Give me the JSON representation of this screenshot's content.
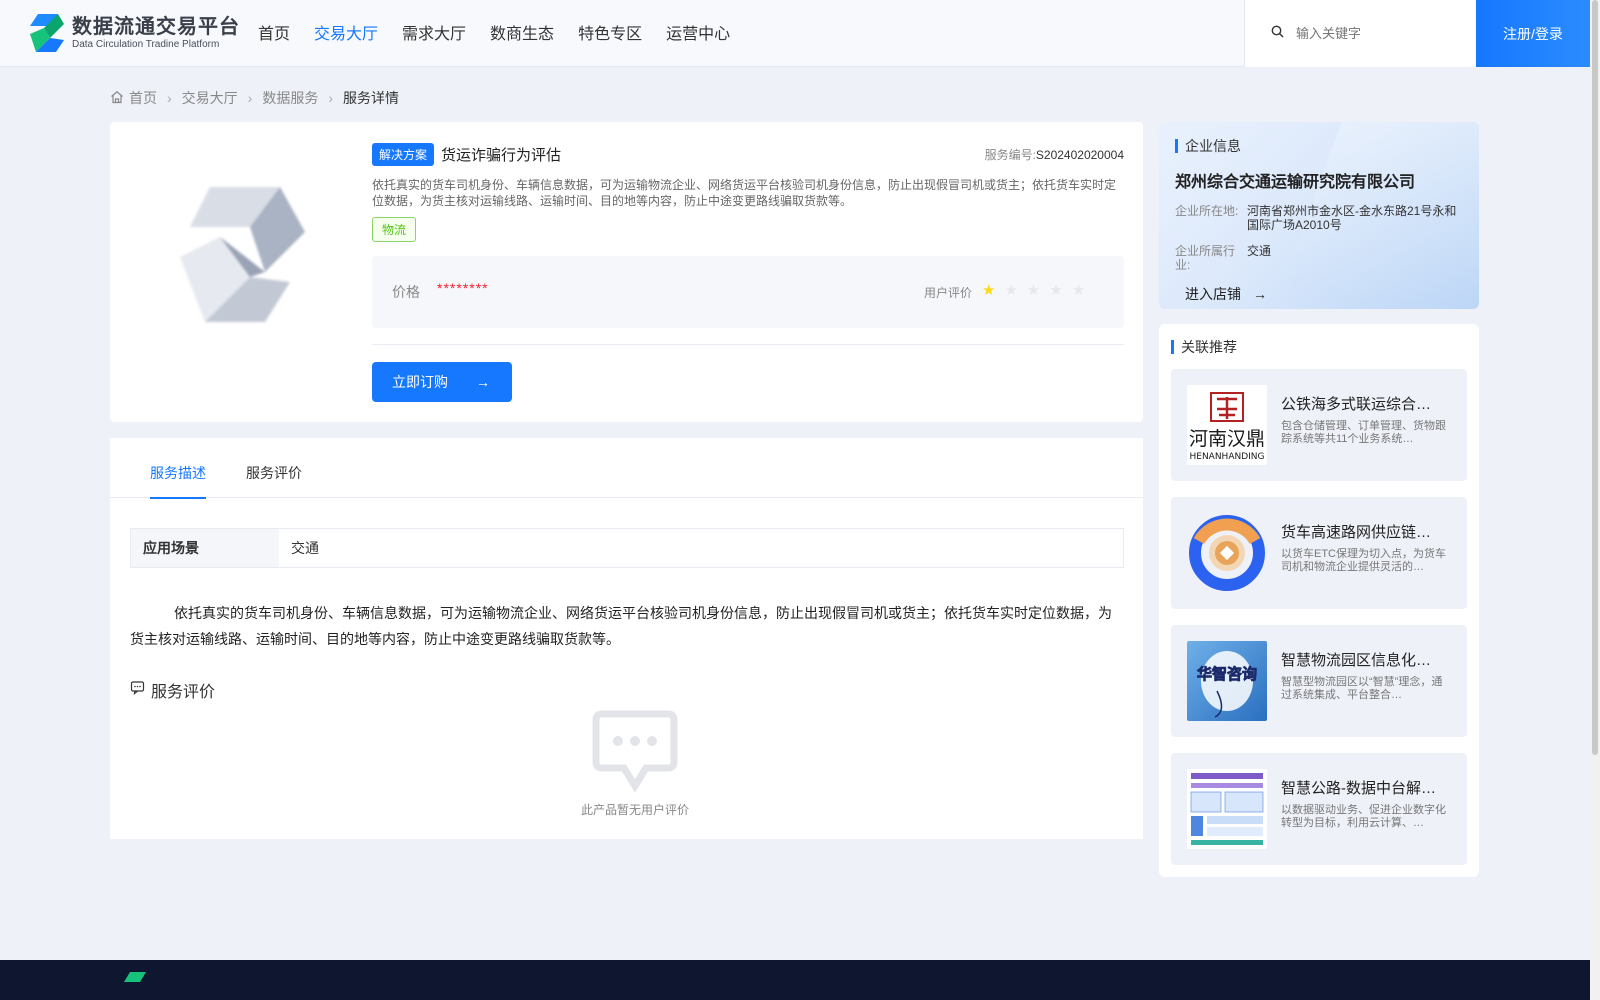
{
  "header": {
    "logo_cn": "数据流通交易平台",
    "logo_en": "Data Circulation Tradine Platform",
    "nav": [
      {
        "label": "首页",
        "active": false
      },
      {
        "label": "交易大厅",
        "active": true
      },
      {
        "label": "需求大厅",
        "active": false
      },
      {
        "label": "数商生态",
        "active": false
      },
      {
        "label": "特色专区",
        "active": false
      },
      {
        "label": "运营中心",
        "active": false
      }
    ],
    "search_placeholder": "输入关键字",
    "login_label": "注册/登录"
  },
  "breadcrumb": [
    "首页",
    "交易大厅",
    "数据服务",
    "服务详情"
  ],
  "product": {
    "tag": "解决方案",
    "title": "货运诈骗行为评估",
    "service_no_label": "服务编号:",
    "service_no": "S202402020004",
    "description": "依托真实的货车司机身份、车辆信息数据，可为运输物流企业、网络货运平台核验司机身份信息，防止出现假冒司机或货主；依托货车实时定位数据，为货主核对运输线路、运输时间、目的地等内容，防止中途变更路线骗取货款等。",
    "category": "物流",
    "price_label": "价格",
    "price_value": "********",
    "rating_label": "用户评价",
    "rating": 1,
    "rating_max": 5,
    "buy_label": "立即订购",
    "accent": "#1677ff"
  },
  "detail": {
    "tabs": [
      {
        "label": "服务描述",
        "active": true
      },
      {
        "label": "服务评价",
        "active": false
      }
    ],
    "scene_key": "应用场景",
    "scene_value": "交通",
    "long_description": "依托真实的货车司机身份、车辆信息数据，可为运输物流企业、网络货运平台核验司机身份信息，防止出现假冒司机或货主；依托货车实时定位数据，为货主核对运输线路、运输时间、目的地等内容，防止中途变更路线骗取货款等。",
    "review_title": "服务评价",
    "empty_text": "此产品暂无用户评价"
  },
  "company": {
    "section_title": "企业信息",
    "name": "郑州综合交通运输研究院有限公司",
    "location_label": "企业所在地:",
    "location": "河南省郑州市金水区-金水东路21号永和国际广场A2010号",
    "industry_label": "企业所属行业:",
    "industry": "交通",
    "enter_store": "进入店铺"
  },
  "related": {
    "section_title": "关联推荐",
    "items": [
      {
        "title": "公铁海多式联运综合…",
        "desc": "包含仓储管理、订单管理、货物跟踪系统等共11个业务系统…",
        "thumb_text": "河南汉鼎",
        "thumb_sub": "HENANHANDING"
      },
      {
        "title": "货车高速路网供应链…",
        "desc": "以货车ETC保理为切入点，为货车司机和物流企业提供灵活的…",
        "thumb_text": "",
        "thumb_sub": ""
      },
      {
        "title": "智慧物流园区信息化…",
        "desc": "智慧型物流园区以“智慧”理念，通过系统集成、平台整合…",
        "thumb_text": "华智咨询",
        "thumb_sub": ""
      },
      {
        "title": "智慧公路-数据中台解…",
        "desc": "以数据驱动业务、促进企业数字化转型为目标，利用云计算、…",
        "thumb_text": "",
        "thumb_sub": ""
      }
    ]
  }
}
